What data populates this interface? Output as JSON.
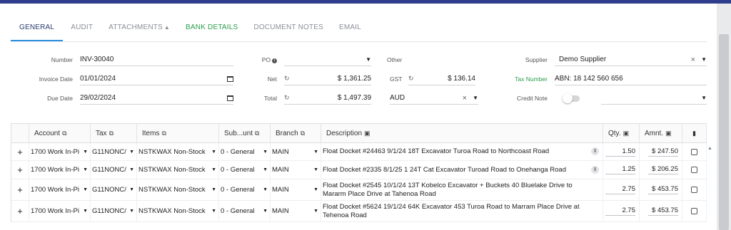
{
  "tabs": [
    {
      "label": "GENERAL"
    },
    {
      "label": "AUDIT"
    },
    {
      "label": "ATTACHMENTS"
    },
    {
      "label": "BANK DETAILS"
    },
    {
      "label": "DOCUMENT NOTES"
    },
    {
      "label": "EMAIL"
    }
  ],
  "form": {
    "number_label": "Number",
    "number_value": "INV-30040",
    "invoice_date_label": "Invoice Date",
    "invoice_date_value": "01/01/2024",
    "due_date_label": "Due Date",
    "due_date_value": "29/02/2024",
    "po_label": "PO",
    "po_value": "",
    "net_label": "Net",
    "net_value": "$ 1,361.25",
    "total_label": "Total",
    "total_value": "$ 1,497.39",
    "other_label": "Other",
    "other_value": "",
    "gst_label": "GST",
    "gst_value": "$ 136.14",
    "currency_value": "AUD",
    "supplier_label": "Supplier",
    "supplier_value": "Demo Supplier",
    "tax_number_label": "Tax Number",
    "tax_number_value": "ABN: 18 142 560 656",
    "credit_note_label": "Credit Note",
    "credit_note_on": false,
    "credit_note_select_value": ""
  },
  "table": {
    "headers": {
      "account": "Account",
      "tax": "Tax",
      "items": "Items",
      "subaccount": "Sub...unt",
      "branch": "Branch",
      "description": "Description",
      "qty": "Qty.",
      "amount": "Amnt."
    },
    "rows": [
      {
        "account": "1700 Work In-Pi",
        "tax": "G11NONC/",
        "item": "NSTKWAX Non-Stock",
        "subaccount": "0 - General",
        "branch": "MAIN",
        "description": "Float Docket #24463 9/1/24 18T Excavator Turoa Road to Northcoast Road",
        "qty": "1.50",
        "amount": "$ 247.50"
      },
      {
        "account": "1700 Work In-Pi",
        "tax": "G11NONC/",
        "item": "NSTKWAX Non-Stock",
        "subaccount": "0 - General",
        "branch": "MAIN",
        "description": "Float Docket #2335 8/1/25 1 24T Cat Excavator Turoad Road to Onehanga Road",
        "qty": "1.25",
        "amount": "$ 206.25"
      },
      {
        "account": "1700 Work In-Pi",
        "tax": "G11NONC/",
        "item": "NSTKWAX Non-Stock",
        "subaccount": "0 - General",
        "branch": "MAIN",
        "description": "Float Docket #2545 10/1/24  13T Kobelco Excavator + Buckets 40 Bluelake Drive to Mararm Place Drive at Tahenoa Road",
        "qty": "2.75",
        "amount": "$ 453.75"
      },
      {
        "account": "1700 Work In-Pi",
        "tax": "G11NONC/",
        "item": "NSTKWAX Non-Stock",
        "subaccount": "0 - General",
        "branch": "MAIN",
        "description": "Float Docket #5624 19/1/24 64K Excavator 453 Turoa Road to Marram Place Drive at Tehenoa Road",
        "qty": "2.75",
        "amount": "$ 453.75"
      }
    ]
  }
}
